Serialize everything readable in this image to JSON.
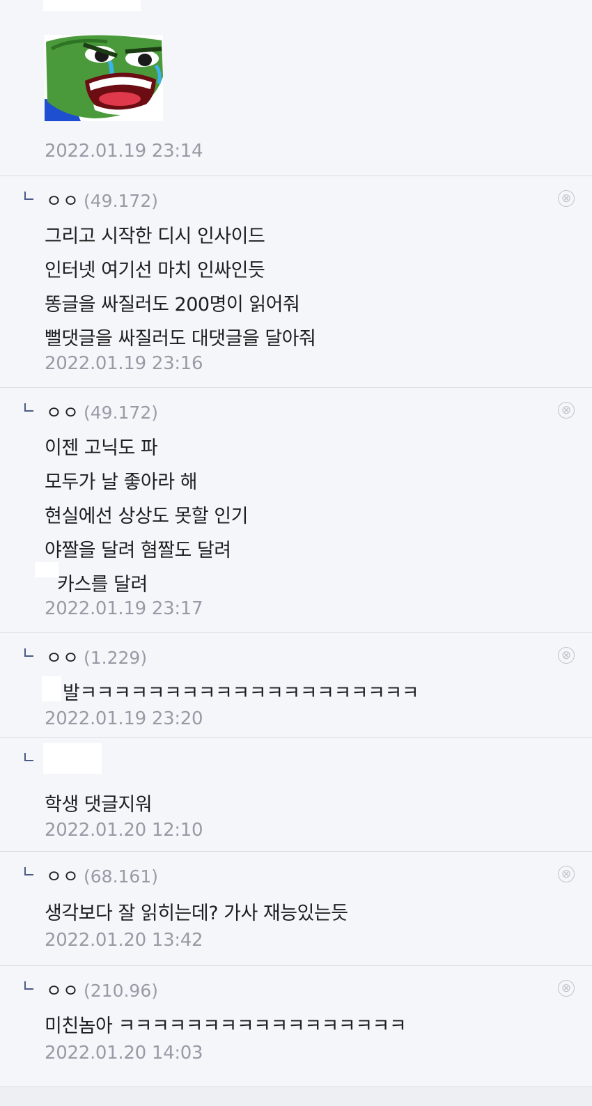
{
  "top": {
    "sticker_icon": "pepe-angry-crying-sticker",
    "timestamp": "2022.01.19 23:14"
  },
  "comments": [
    {
      "nick": "ㅇㅇ",
      "ip": "(49.172)",
      "lines": [
        "그리고 시작한 디시 인사이드",
        "인터넷 여기선 마치 인싸인듯",
        "똥글을 싸질러도 200명이 읽어줘",
        "뻘댓글을 싸질러도 대댓글을 달아줘"
      ],
      "timestamp": "2022.01.19 23:16"
    },
    {
      "nick": "ㅇㅇ",
      "ip": "(49.172)",
      "lines": [
        "이젠 고닉도 파",
        "모두가 날 좋아라 해",
        "현실에선 상상도 못할 인기",
        "야짤을 달려 혐짤도 달려",
        "카스를 달려"
      ],
      "timestamp": "2022.01.19 23:17"
    },
    {
      "nick": "ㅇㅇ",
      "ip": "(1.229)",
      "lines": [
        "발ㅋㅋㅋㅋㅋㅋㅋㅋㅋㅋㅋㅋㅋㅋㅋㅋㅋㅋㅋㅋ"
      ],
      "timestamp": "2022.01.19 23:20"
    },
    {
      "nick": "",
      "ip": "",
      "lines": [
        "학생 댓글지워"
      ],
      "timestamp": "2022.01.20 12:10"
    },
    {
      "nick": "ㅇㅇ",
      "ip": "(68.161)",
      "lines": [
        "생각보다 잘 읽히는데? 가사 재능있는듯"
      ],
      "timestamp": "2022.01.20 13:42"
    },
    {
      "nick": "ㅇㅇ",
      "ip": "(210.96)",
      "lines": [
        "미친놈아 ㅋㅋㅋㅋㅋㅋㅋㅋㅋㅋㅋㅋㅋㅋㅋㅋㅋ"
      ],
      "timestamp": "2022.01.20 14:03"
    }
  ],
  "icons": {
    "delete": "⊗",
    "reply": "reply-corner-icon"
  },
  "colors": {
    "background": "#f5f6fa",
    "timestamp": "#9a9aa6",
    "reply_mark": "#4a5a86",
    "divider": "#dcdde3"
  }
}
